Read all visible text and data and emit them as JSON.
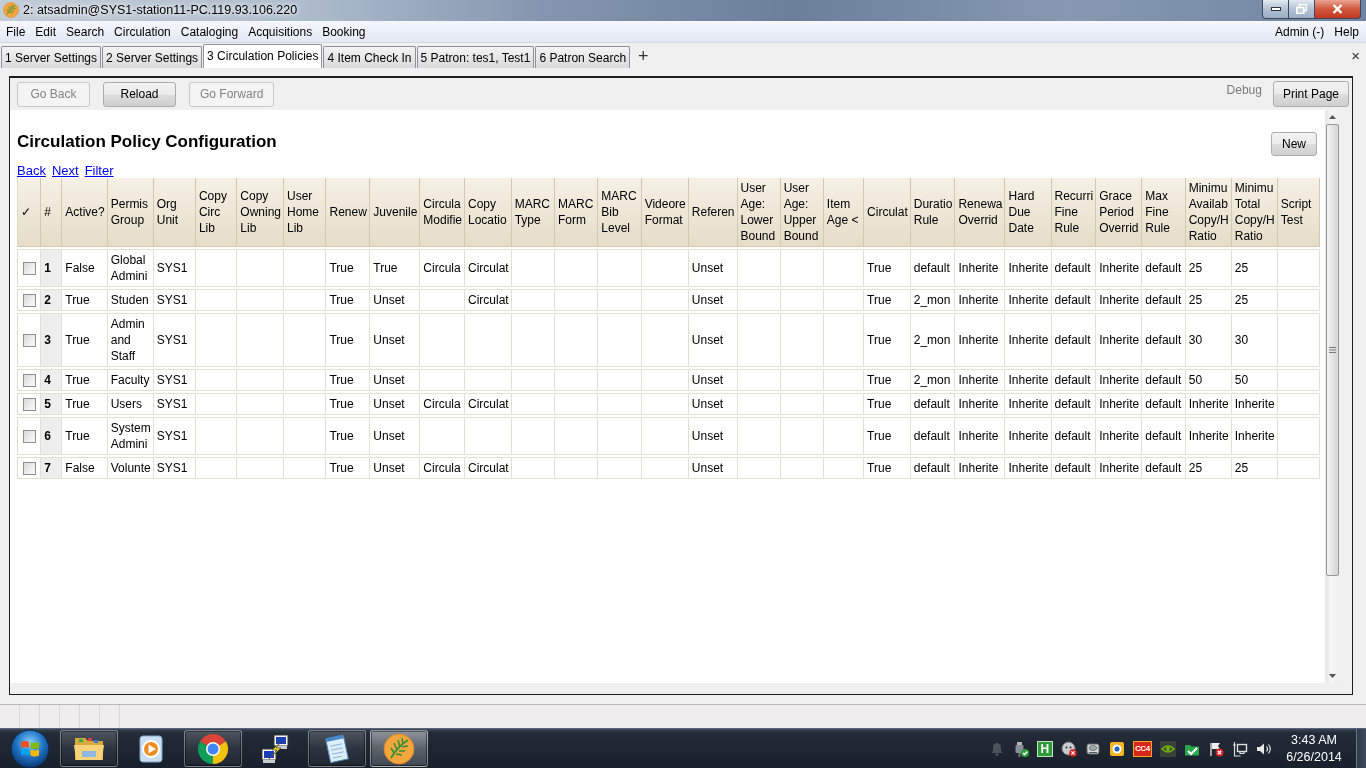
{
  "window": {
    "title": "2: atsadmin@SYS1-station11-PC.119.93.106.220"
  },
  "menu_bar": {
    "items": [
      "File",
      "Edit",
      "Search",
      "Circulation",
      "Cataloging",
      "Acquisitions",
      "Booking"
    ],
    "right_items": [
      "Admin (-)",
      "Help"
    ]
  },
  "tabs": [
    {
      "label": "1 Server Settings",
      "selected": false
    },
    {
      "label": "2 Server Settings",
      "selected": false
    },
    {
      "label": "3 Circulation Policies",
      "selected": true
    },
    {
      "label": "4 Item Check In",
      "selected": false
    },
    {
      "label": "5 Patron: tes1, Test1",
      "selected": false
    },
    {
      "label": "6 Patron Search",
      "selected": false
    }
  ],
  "tab_bar": {
    "add_button": "+",
    "close_button": "×"
  },
  "toolbar": {
    "buttons": [
      {
        "label": "Go Back",
        "disabled": true
      },
      {
        "label": "Reload",
        "disabled": false
      },
      {
        "label": "Go Forward",
        "disabled": true
      }
    ],
    "debug": "Debug",
    "print_button": "Print Page"
  },
  "page": {
    "heading": "Circulation Policy Configuration",
    "new_button": "New",
    "links": [
      "Back",
      "Next",
      "Filter"
    ],
    "table": {
      "columns": [
        "✓",
        "#",
        "Active?",
        "Permis Group",
        "Org Unit",
        "Copy Circ Lib",
        "Copy Owning Lib",
        "User Home Lib",
        "Renew",
        "Juvenile",
        "Circula Modifie",
        "Copy Locatio",
        "MARC Type",
        "MARC Form",
        "MARC Bib Level",
        "Videore Format",
        "Referen",
        "User Age: Lower Bound",
        "User Age: Upper Bound",
        "Item Age <",
        "Circulat",
        "Duratio Rule",
        "Renewa Overrid",
        "Hard Due Date",
        "Recurri Fine Rule",
        "Grace Period Overrid",
        "Max Fine Rule",
        "Minimu Availab Copy/H Ratio",
        "Minimu Total Copy/H Ratio",
        "Script Test"
      ],
      "rows": [
        {
          "checked": false,
          "cells": [
            "",
            "1",
            "False",
            "Global Admini",
            "SYS1",
            null,
            null,
            null,
            "True",
            "True",
            "Circula",
            "Circulat",
            null,
            null,
            null,
            null,
            "Unset",
            null,
            null,
            null,
            "True",
            "default",
            "Inherite",
            "Inherite",
            "default",
            "Inherite",
            "default",
            "25",
            "25",
            null
          ]
        },
        {
          "checked": false,
          "cells": [
            "",
            "2",
            "True",
            "Studen",
            "SYS1",
            null,
            null,
            null,
            "True",
            "Unset",
            null,
            "Circulat",
            null,
            null,
            null,
            null,
            "Unset",
            null,
            null,
            null,
            "True",
            "2_mon",
            "Inherite",
            "Inherite",
            "default",
            "Inherite",
            "default",
            "25",
            "25",
            null
          ]
        },
        {
          "checked": false,
          "cells": [
            "",
            "3",
            "True",
            "Admin and Staff",
            "SYS1",
            null,
            null,
            null,
            "True",
            "Unset",
            null,
            null,
            null,
            null,
            null,
            null,
            "Unset",
            null,
            null,
            null,
            "True",
            "2_mon",
            "Inherite",
            "Inherite",
            "default",
            "Inherite",
            "default",
            "30",
            "30",
            null
          ]
        },
        {
          "checked": false,
          "cells": [
            "",
            "4",
            "True",
            "Faculty",
            "SYS1",
            null,
            null,
            null,
            "True",
            "Unset",
            null,
            null,
            null,
            null,
            null,
            null,
            "Unset",
            null,
            null,
            null,
            "True",
            "2_mon",
            "Inherite",
            "Inherite",
            "default",
            "Inherite",
            "default",
            "50",
            "50",
            null
          ]
        },
        {
          "checked": false,
          "cells": [
            "",
            "5",
            "True",
            "Users",
            "SYS1",
            null,
            null,
            null,
            "True",
            "Unset",
            "Circula",
            "Circulat",
            null,
            null,
            null,
            null,
            "Unset",
            null,
            null,
            null,
            "True",
            "default",
            "Inherite",
            "Inherite",
            "default",
            "Inherite",
            "default",
            "Inherite",
            "Inherite",
            null
          ]
        },
        {
          "checked": false,
          "cells": [
            "",
            "6",
            "True",
            "System Admini",
            "SYS1",
            null,
            null,
            null,
            "True",
            "Unset",
            null,
            null,
            null,
            null,
            null,
            null,
            "Unset",
            null,
            null,
            null,
            "True",
            "default",
            "Inherite",
            "Inherite",
            "default",
            "Inherite",
            "default",
            "Inherite",
            "Inherite",
            null
          ]
        },
        {
          "checked": false,
          "cells": [
            "",
            "7",
            "False",
            "Volunte",
            "SYS1",
            null,
            null,
            null,
            "True",
            "Unset",
            "Circula",
            "Circulat",
            null,
            null,
            null,
            null,
            "Unset",
            null,
            null,
            null,
            "True",
            "default",
            "Inherite",
            "Inherite",
            "default",
            "Inherite",
            "default",
            "25",
            "25",
            null
          ]
        }
      ]
    }
  },
  "taskbar": {
    "apps": [
      {
        "kind": "folder",
        "running": true,
        "selected": false
      },
      {
        "kind": "player",
        "running": false,
        "selected": false
      },
      {
        "kind": "browser",
        "running": true,
        "selected": false
      },
      {
        "kind": "remote",
        "running": false,
        "selected": false
      },
      {
        "kind": "notepad",
        "running": true,
        "selected": false
      },
      {
        "kind": "leaf",
        "running": true,
        "selected": true
      }
    ],
    "tray_badges": [
      "H",
      "CC4"
    ],
    "time": "3:43 AM",
    "date": "6/26/2014"
  }
}
